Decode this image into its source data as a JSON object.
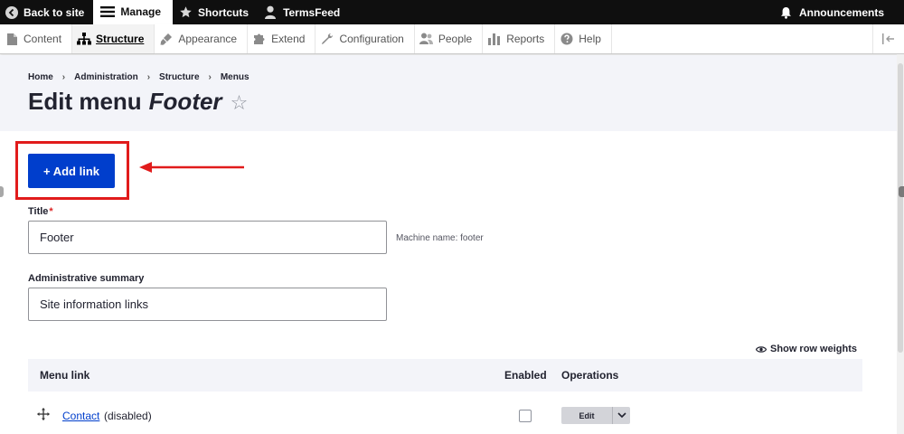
{
  "topbar": {
    "back_label": "Back to site",
    "manage_label": "Manage",
    "shortcuts_label": "Shortcuts",
    "user_label": "TermsFeed",
    "announcements_label": "Announcements"
  },
  "tray": {
    "items": [
      {
        "label": "Content",
        "icon": "file-icon"
      },
      {
        "label": "Structure",
        "icon": "sitemap-icon"
      },
      {
        "label": "Appearance",
        "icon": "brush-icon"
      },
      {
        "label": "Extend",
        "icon": "puzzle-icon"
      },
      {
        "label": "Configuration",
        "icon": "wrench-icon"
      },
      {
        "label": "People",
        "icon": "people-icon"
      },
      {
        "label": "Reports",
        "icon": "bar-chart-icon"
      },
      {
        "label": "Help",
        "icon": "help-icon"
      }
    ],
    "active": "Structure"
  },
  "breadcrumb": [
    "Home",
    "Administration",
    "Structure",
    "Menus"
  ],
  "page": {
    "title_prefix": "Edit menu",
    "title_name": "Footer",
    "star_glyph": "☆"
  },
  "actions": {
    "add_link_label": "+ Add link"
  },
  "form": {
    "title_label": "Title",
    "required_mark": "*",
    "title_value": "Footer",
    "machine_name": "Machine name: footer",
    "summary_label": "Administrative summary",
    "summary_value": "Site information links"
  },
  "table": {
    "show_weights_label": "Show row weights",
    "headers": {
      "menu_link": "Menu link",
      "enabled": "Enabled",
      "operations": "Operations"
    },
    "rows": [
      {
        "link": "Contact",
        "status": "(disabled)",
        "enabled": false,
        "op_label": "Edit"
      }
    ]
  },
  "colors": {
    "primary": "#003ecc",
    "highlight": "#e11b1b",
    "toolbar": "#0f0f0f"
  }
}
